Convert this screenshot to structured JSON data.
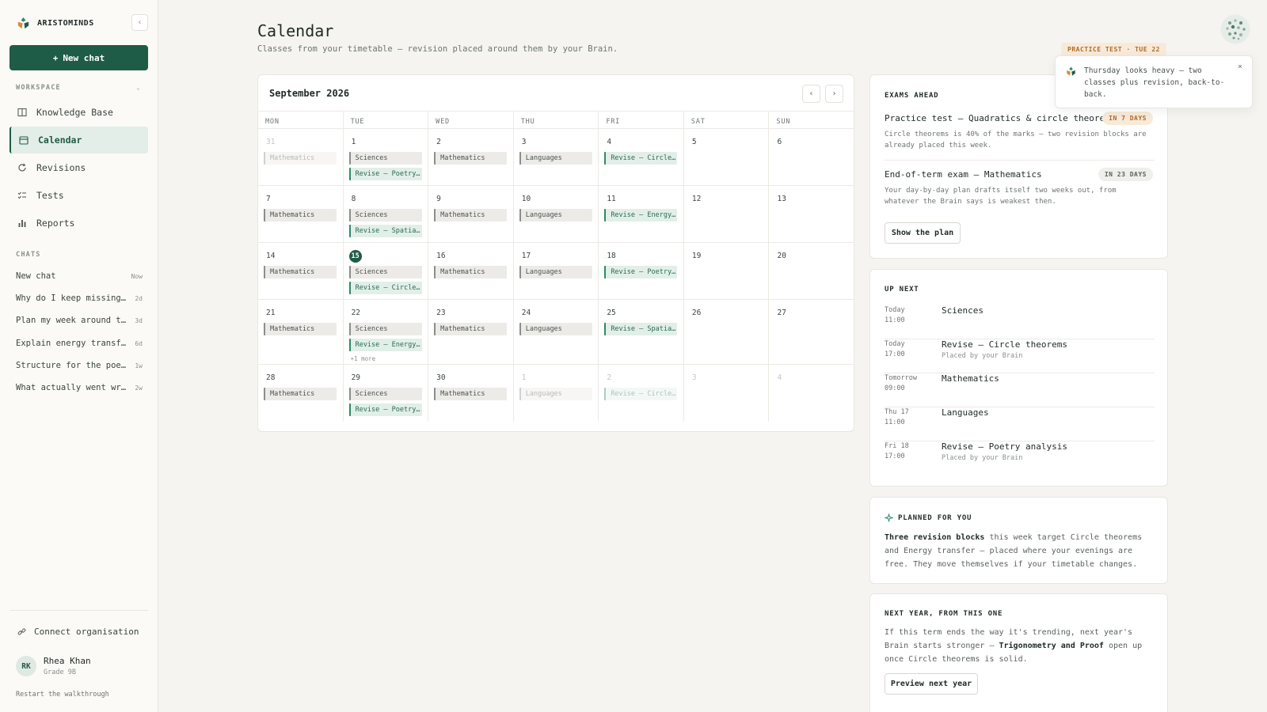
{
  "brand": {
    "name": "ARISTOMINDS"
  },
  "sidebar": {
    "new_chat_label": "New chat",
    "workspace_label": "WORKSPACE",
    "nav": [
      {
        "label": "Knowledge Base",
        "icon": "book-icon"
      },
      {
        "label": "Calendar",
        "icon": "calendar-icon",
        "active": true
      },
      {
        "label": "Revisions",
        "icon": "refresh-icon"
      },
      {
        "label": "Tests",
        "icon": "checklist-icon"
      },
      {
        "label": "Reports",
        "icon": "bar-chart-icon"
      }
    ],
    "chats_label": "CHATS",
    "chats": [
      {
        "title": "New chat",
        "age": "Now"
      },
      {
        "title": "Why do I keep missing c…",
        "age": "2d"
      },
      {
        "title": "Plan my week around the…",
        "age": "3d"
      },
      {
        "title": "Explain energy transfer…",
        "age": "6d"
      },
      {
        "title": "Structure for the poetr…",
        "age": "1w"
      },
      {
        "title": "What actually went wron…",
        "age": "2w"
      }
    ],
    "connect_label": "Connect organisation",
    "user": {
      "initials": "RK",
      "name": "Rhea Khan",
      "grade": "Grade 9B"
    },
    "restart_label": "Restart the walkthrough"
  },
  "header": {
    "title": "Calendar",
    "subtitle": "Classes from your timetable — revision placed around them by your Brain."
  },
  "calendar": {
    "month": "September 2026",
    "days_of_week": [
      "MON",
      "TUE",
      "WED",
      "THU",
      "FRI",
      "SAT",
      "SUN"
    ],
    "weeks": [
      [
        {
          "n": "31",
          "out": true,
          "events": [
            {
              "t": "Mathematics",
              "k": "class"
            }
          ]
        },
        {
          "n": "1",
          "events": [
            {
              "t": "Sciences",
              "k": "class"
            },
            {
              "t": "Revise — Poetry analysis",
              "k": "rev"
            }
          ]
        },
        {
          "n": "2",
          "events": [
            {
              "t": "Mathematics",
              "k": "class"
            }
          ]
        },
        {
          "n": "3",
          "events": [
            {
              "t": "Languages",
              "k": "class"
            }
          ]
        },
        {
          "n": "4",
          "events": [
            {
              "t": "Revise — Circle theorems",
              "k": "rev"
            }
          ]
        },
        {
          "n": "5",
          "events": []
        },
        {
          "n": "6",
          "events": []
        }
      ],
      [
        {
          "n": "7",
          "events": [
            {
              "t": "Mathematics",
              "k": "class"
            }
          ]
        },
        {
          "n": "8",
          "events": [
            {
              "t": "Sciences",
              "k": "class"
            },
            {
              "t": "Revise — Spatial reasoning",
              "k": "rev"
            }
          ]
        },
        {
          "n": "9",
          "events": [
            {
              "t": "Mathematics",
              "k": "class"
            }
          ]
        },
        {
          "n": "10",
          "events": [
            {
              "t": "Languages",
              "k": "class"
            }
          ]
        },
        {
          "n": "11",
          "events": [
            {
              "t": "Revise — Energy transfer",
              "k": "rev"
            }
          ]
        },
        {
          "n": "12",
          "events": []
        },
        {
          "n": "13",
          "events": []
        }
      ],
      [
        {
          "n": "14",
          "events": [
            {
              "t": "Mathematics",
              "k": "class"
            }
          ]
        },
        {
          "n": "15",
          "today": true,
          "events": [
            {
              "t": "Sciences",
              "k": "class"
            },
            {
              "t": "Revise — Circle theorems",
              "k": "rev"
            }
          ]
        },
        {
          "n": "16",
          "events": [
            {
              "t": "Mathematics",
              "k": "class"
            }
          ]
        },
        {
          "n": "17",
          "events": [
            {
              "t": "Languages",
              "k": "class"
            }
          ]
        },
        {
          "n": "18",
          "events": [
            {
              "t": "Revise — Poetry analysis",
              "k": "rev"
            }
          ]
        },
        {
          "n": "19",
          "events": []
        },
        {
          "n": "20",
          "events": []
        }
      ],
      [
        {
          "n": "21",
          "events": [
            {
              "t": "Mathematics",
              "k": "class"
            }
          ]
        },
        {
          "n": "22",
          "events": [
            {
              "t": "Sciences",
              "k": "class"
            },
            {
              "t": "Revise — Energy transfer",
              "k": "rev"
            }
          ],
          "more": "+1 more"
        },
        {
          "n": "23",
          "events": [
            {
              "t": "Mathematics",
              "k": "class"
            }
          ]
        },
        {
          "n": "24",
          "events": [
            {
              "t": "Languages",
              "k": "class"
            }
          ]
        },
        {
          "n": "25",
          "events": [
            {
              "t": "Revise — Spatial reasoning",
              "k": "rev"
            }
          ]
        },
        {
          "n": "26",
          "events": []
        },
        {
          "n": "27",
          "events": []
        }
      ],
      [
        {
          "n": "28",
          "events": [
            {
              "t": "Mathematics",
              "k": "class"
            }
          ]
        },
        {
          "n": "29",
          "events": [
            {
              "t": "Sciences",
              "k": "class"
            },
            {
              "t": "Revise — Poetry analysis",
              "k": "rev"
            }
          ]
        },
        {
          "n": "30",
          "events": [
            {
              "t": "Mathematics",
              "k": "class"
            }
          ]
        },
        {
          "n": "1",
          "out": true,
          "events": [
            {
              "t": "Languages",
              "k": "class"
            }
          ]
        },
        {
          "n": "2",
          "out": true,
          "events": [
            {
              "t": "Revise — Circle theorems",
              "k": "rev"
            }
          ]
        },
        {
          "n": "3",
          "out": true,
          "events": []
        },
        {
          "n": "4",
          "out": true,
          "events": []
        }
      ]
    ]
  },
  "exams": {
    "title": "EXAMS AHEAD",
    "items": [
      {
        "title": "Practice test — Quadratics & circle theorems",
        "badge": "IN 7 DAYS",
        "desc": "Circle theorems is 40% of the marks — two revision blocks are already placed this week."
      },
      {
        "title": "End-of-term exam — Mathematics",
        "badge": "IN 23 DAYS",
        "desc": "Your day-by-day plan drafts itself two weeks out, from whatever the Brain says is weakest then."
      }
    ],
    "button": "Show the plan"
  },
  "up_next": {
    "title": "UP NEXT",
    "items": [
      {
        "day": "Today",
        "time": "11:00",
        "name": "Sciences",
        "note": ""
      },
      {
        "day": "Today",
        "time": "17:00",
        "name": "Revise — Circle theorems",
        "note": "Placed by your Brain"
      },
      {
        "day": "Tomorrow",
        "time": "09:00",
        "name": "Mathematics",
        "note": ""
      },
      {
        "day": "Thu 17",
        "time": "11:00",
        "name": "Languages",
        "note": ""
      },
      {
        "day": "Fri 18",
        "time": "17:00",
        "name": "Revise — Poetry analysis",
        "note": "Placed by your Brain"
      }
    ]
  },
  "planned": {
    "title": "PLANNED FOR YOU",
    "bold": "Three revision blocks",
    "text": " this week target Circle theorems and Energy transfer — placed where your evenings are free. They move themselves if your timetable changes."
  },
  "next_year": {
    "title": "NEXT YEAR, FROM THIS ONE",
    "text1": "If this term ends the way it's trending, next year's Brain starts stronger — ",
    "bold": "Trigonometry and Proof",
    "text2": " open up once Circle theorems is solid.",
    "button": "Preview next year"
  },
  "toast": {
    "badge": "PRACTICE TEST · TUE 22",
    "text": "Thursday looks heavy — two classes plus revision, back-to-back.",
    "close": "×"
  },
  "colors": {
    "accent": "#1e5c47",
    "warn": "#b26a27",
    "revision": "#2f8a68"
  }
}
